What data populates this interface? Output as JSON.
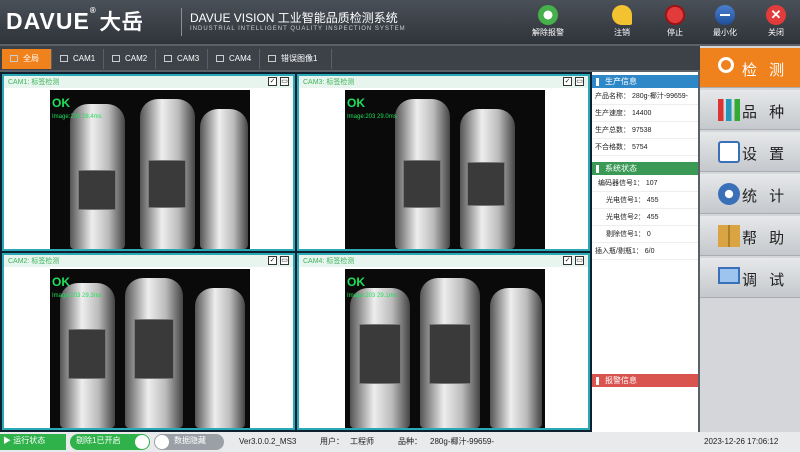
{
  "brand": {
    "logo": "DAVUE",
    "logo_reg": "®",
    "logo_cn": "大岳",
    "title": "DAVUE VISION 工业智能品质检测系统",
    "subtitle": "INDUSTRIAL INTELLIGENT QUALITY INSPECTION SYSTEM"
  },
  "toolbar": {
    "release_alarm": "解除报警",
    "logout": "注销",
    "stop": "停止",
    "minimize": "最小化",
    "close": "关闭"
  },
  "tabs": [
    "全局",
    "CAM1",
    "CAM2",
    "CAM3",
    "CAM4",
    "错误图像1"
  ],
  "cams": [
    {
      "title": "CAM1: 标签检测",
      "result": "OK",
      "meta": "Image:203  28.4ms"
    },
    {
      "title": "CAM3: 标签检测",
      "result": "OK",
      "meta": "Image:203  29.0ms"
    },
    {
      "title": "CAM2: 标签检测",
      "result": "OK",
      "meta": "Image:203  29.3ms"
    },
    {
      "title": "CAM4: 标签检测",
      "result": "OK",
      "meta": "Image:203  29.1ms"
    }
  ],
  "production": {
    "header": "生产信息",
    "rows": [
      "产品名称： 280g-椰汁-99659-",
      "生产速度： 14400",
      "生产总数： 97538",
      "不合格数： 5754"
    ]
  },
  "system": {
    "header": "系统状态",
    "rows": [
      "编码器信号1： 107",
      "光电信号1： 455",
      "光电信号2： 455",
      "剔除信号1： 0",
      "插入瓶/剔瓶1： 6/0"
    ]
  },
  "alarm": {
    "header": "报警信息"
  },
  "nav": [
    "检 测",
    "品 种",
    "设 置",
    "统 计",
    "帮 助",
    "调 试"
  ],
  "statusbar": {
    "run_state": "运行状态",
    "reject_toggle": "剔除1已开启",
    "data_hide": "数据隐藏",
    "version": "Ver3.0.0.2_MS3",
    "user_label": "用户：",
    "user": "工程师",
    "variety_label": "品种：",
    "variety": "280g-椰汁-99659-",
    "datetime": "2023-12-26  17:06:12"
  },
  "colors": {
    "accent": "#f0821e",
    "ok_green": "#1ee05a",
    "production_header": "#2e88c8",
    "system_header": "#3a9a55",
    "alarm_header": "#d9534f"
  }
}
